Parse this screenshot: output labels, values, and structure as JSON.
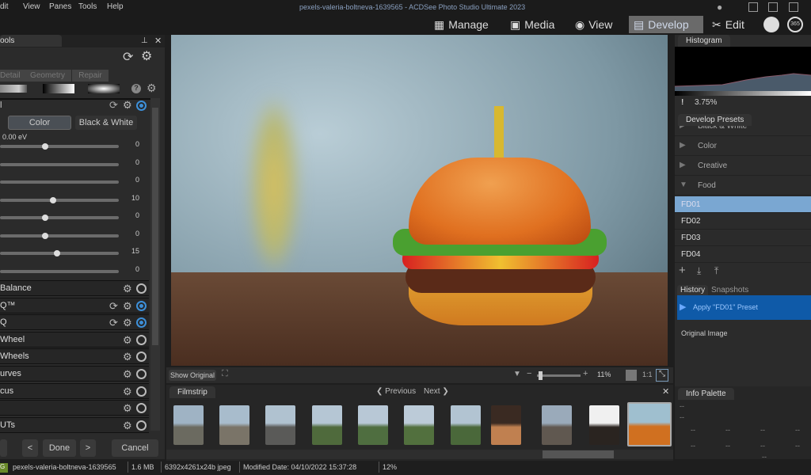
{
  "menubar": {
    "items": [
      "dit",
      "View",
      "Panes",
      "Tools",
      "Help"
    ],
    "title": "pexels-valeria-boltneva-1639565 - ACDSee Photo Studio Ultimate 2023"
  },
  "modes": [
    {
      "label": "Manage",
      "icon": "grid-icon"
    },
    {
      "label": "Media",
      "icon": "media-icon"
    },
    {
      "label": "View",
      "icon": "eye-icon"
    },
    {
      "label": "Develop",
      "icon": "develop-icon",
      "active": true
    },
    {
      "label": "Edit",
      "icon": "edit-tools-icon"
    }
  ],
  "tools": {
    "title": "ools",
    "tabs": [
      "Detail",
      "Geometry",
      "Repair"
    ],
    "section": "l",
    "color_btn": "Color",
    "bw_btn": "Black & White",
    "exposure": "0.00 eV",
    "sliders": [
      {
        "value": "0",
        "pos": 0.35
      },
      {
        "value": "0",
        "pos": null
      },
      {
        "value": "0",
        "pos": null
      },
      {
        "value": "10",
        "pos": 0.42
      },
      {
        "value": "0",
        "pos": 0.35
      },
      {
        "value": "0",
        "pos": 0.35
      },
      {
        "value": "15",
        "pos": 0.45
      },
      {
        "value": "0",
        "pos": null
      }
    ],
    "sections": [
      {
        "label": "Balance",
        "on": false,
        "reset": false
      },
      {
        "label": "Q™",
        "on": true,
        "reset": true
      },
      {
        "label": "Q",
        "on": true,
        "reset": true
      },
      {
        "label": "Wheel",
        "on": false,
        "reset": false
      },
      {
        "label": "Wheels",
        "on": false,
        "reset": false
      },
      {
        "label": "urves",
        "on": false,
        "reset": false
      },
      {
        "label": "cus",
        "on": false,
        "reset": false
      },
      {
        "label": "",
        "on": false,
        "reset": false
      },
      {
        "label": "UTs",
        "on": false,
        "reset": false
      }
    ],
    "done": "Done",
    "cancel": "Cancel"
  },
  "viewer": {
    "show_original": "Show Original",
    "zoom": "11%",
    "one_to_one": "1:1"
  },
  "filmstrip": {
    "title": "Filmstrip",
    "previous": "Previous",
    "next": "Next",
    "thumbs": [
      [
        "#9fb3c4",
        "#6b6a60"
      ],
      [
        "#a8bccc",
        "#7a7468"
      ],
      [
        "#b0c2d0",
        "#5a5a58"
      ],
      [
        "#b5c6d4",
        "#4f6a3c"
      ],
      [
        "#b8c8d6",
        "#4f6e40"
      ],
      [
        "#bccbd8",
        "#52703e"
      ],
      [
        "#b2c4d2",
        "#4a683a"
      ],
      [
        "#3a2a22",
        "#c08050"
      ],
      [
        "#9aaaba",
        "#605850"
      ],
      [
        "#f0f0f0",
        "#2a2420"
      ],
      [
        "#9fbfcf",
        "#d07020"
      ]
    ]
  },
  "histogram": {
    "title": "Histogram",
    "clip": "3.75%"
  },
  "presets": {
    "title": "Develop Presets",
    "groups": [
      "Black & White",
      "Color",
      "Creative",
      "Food"
    ],
    "items": [
      "FD01",
      "FD02",
      "FD03",
      "FD04"
    ],
    "selected": "FD01"
  },
  "history": {
    "tabs": [
      "History",
      "Snapshots"
    ],
    "items": [
      "Apply \"FD01\" Preset",
      "Original Image"
    ]
  },
  "info": {
    "title": "Info Palette",
    "placeholder": "--"
  },
  "status": {
    "filename": "pexels-valeria-boltneva-1639565",
    "size": "1.6 MB",
    "dims": "6392x4261x24b jpeg",
    "modified": "Modified Date: 04/10/2022 15:37:28",
    "zoom": "12%"
  },
  "colors": {
    "accent": "#3d8fd8",
    "selected_preset": "#7aa7d2",
    "history_selected": "#0f5aa8"
  }
}
